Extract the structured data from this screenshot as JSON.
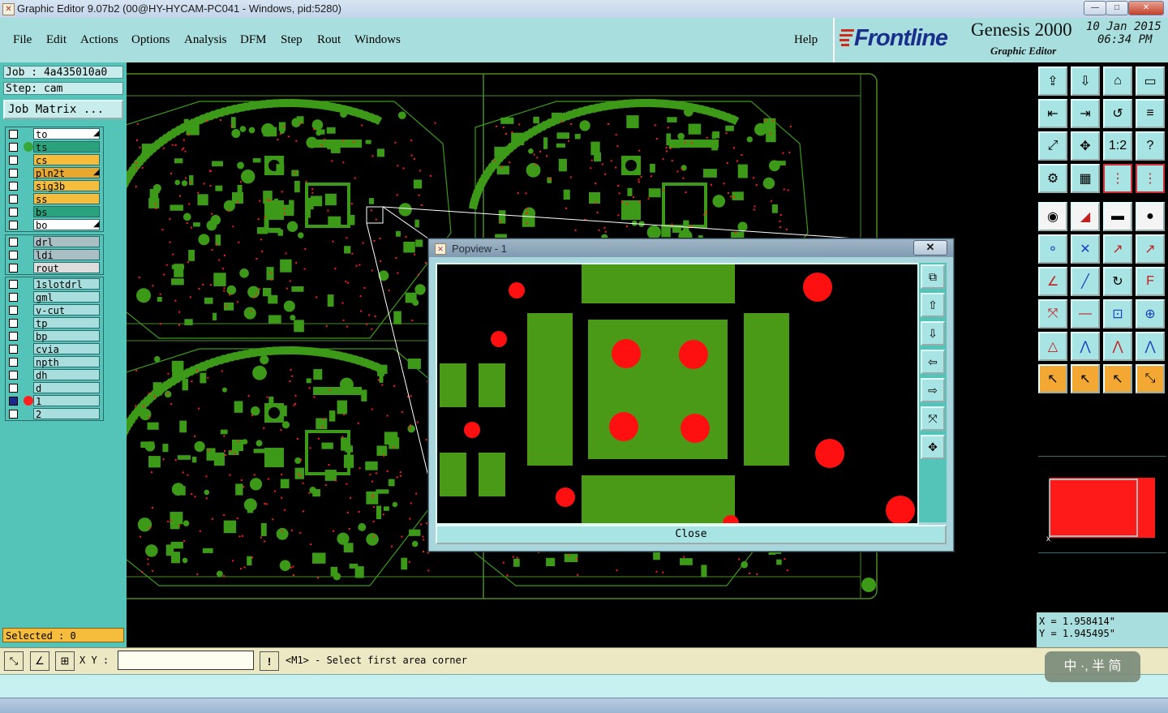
{
  "window": {
    "title": "Graphic Editor 9.07b2 (00@HY-HYCAM-PC041 - Windows, pid:5280)",
    "minimize_glyph": "—",
    "maximize_glyph": "□",
    "close_glyph": "✕"
  },
  "menu": {
    "items": [
      "File",
      "Edit",
      "Actions",
      "Options",
      "Analysis",
      "DFM",
      "Step",
      "Rout",
      "Windows"
    ],
    "help": "Help"
  },
  "branding": {
    "vendor": "Frontline",
    "product": "Genesis 2000",
    "subtitle": "Graphic Editor",
    "date": "10 Jan 2015",
    "time": "06:34 PM"
  },
  "job": {
    "job_label": "Job : 4a435010a0",
    "step_label": "Step: cam",
    "job_matrix_button": "Job Matrix ..."
  },
  "layers_board": [
    {
      "name": "to",
      "color": "#ffffff",
      "dot": "",
      "arrow": true
    },
    {
      "name": "ts",
      "color": "#2aa37c",
      "dot": "#36a83a",
      "arrow": false
    },
    {
      "name": "cs",
      "color": "#f6bc3c",
      "dot": "",
      "arrow": false
    },
    {
      "name": "pln2t",
      "color": "#e8a830",
      "dot": "",
      "arrow": true
    },
    {
      "name": "sig3b",
      "color": "#f6bc3c",
      "dot": "",
      "arrow": false
    },
    {
      "name": "ss",
      "color": "#f6bc3c",
      "dot": "",
      "arrow": false
    },
    {
      "name": "bs",
      "color": "#2aa37c",
      "dot": "",
      "arrow": false
    },
    {
      "name": "bo",
      "color": "#ffffff",
      "dot": "",
      "arrow": true
    }
  ],
  "layers_drill": [
    {
      "name": "drl",
      "color": "#a9bfc4"
    },
    {
      "name": "ldi",
      "color": "#a9bfc4"
    },
    {
      "name": "rout",
      "color": "#dddddd"
    }
  ],
  "layers_misc": [
    {
      "name": "1slotdrl",
      "color": "#a8dede",
      "dot": ""
    },
    {
      "name": "gml",
      "color": "#a8dede",
      "dot": ""
    },
    {
      "name": "v-cut",
      "color": "#a8dede",
      "dot": ""
    },
    {
      "name": "tp",
      "color": "#a8dede",
      "dot": ""
    },
    {
      "name": "bp",
      "color": "#a8dede",
      "dot": ""
    },
    {
      "name": "cvia",
      "color": "#a8dede",
      "dot": ""
    },
    {
      "name": "npth",
      "color": "#a8dede",
      "dot": ""
    },
    {
      "name": "dh",
      "color": "#a8dede",
      "dot": ""
    },
    {
      "name": "d",
      "color": "#a8dede",
      "dot": ""
    },
    {
      "name": "1",
      "color": "#a8dede",
      "dot": "#ff2020"
    },
    {
      "name": "2",
      "color": "#a8dede",
      "dot": ""
    }
  ],
  "selected_label": "Selected : 0",
  "popview": {
    "title": "Popview - 1",
    "close_button": "Close",
    "title_close_glyph": "✕"
  },
  "coords": {
    "x_label": "X = 1.958414\"",
    "y_label": "Y = 1.945495\""
  },
  "bottom": {
    "xy_label": "X Y :",
    "xy_value": "",
    "warn_glyph": "!",
    "status_text": "<M1> - Select first area corner"
  },
  "ime": {
    "label": "中 ·, 半 简"
  },
  "toolbar_icons": [
    "zoom-home-icon",
    "zoom-in-icon",
    "zoom-fit-icon",
    "zoom-window-icon",
    "pan-left-icon",
    "pan-right-icon",
    "flip-view-icon",
    "snap-icon",
    "fit-all-icon",
    "center-view-icon",
    "scale-1to2-icon",
    "help-icon",
    "measure-icon",
    "grid-icon",
    "layer-feed-icon",
    "layer-stack-icon",
    "pad-icon",
    "line-icon",
    "ruler-icon",
    "circle-icon",
    "node-connect-icon",
    "cross-icon",
    "segment-icon",
    "arc-point-icon",
    "draw-line-icon",
    "diag-line-icon",
    "rotate-icon",
    "text-icon",
    "move-icon",
    "split-icon",
    "step-repeat-icon",
    "group-icon",
    "arc-tool-icon",
    "arc2-tool-icon",
    "arc3-tool-icon",
    "arc4-tool-icon",
    "select-arrow-icon",
    "select-box-icon",
    "select-lasso-icon",
    "select-path-icon"
  ],
  "colors": {
    "copper_green": "#4a9a18",
    "drill_red": "#ff1010",
    "panel_cyan": "#a8dede"
  }
}
